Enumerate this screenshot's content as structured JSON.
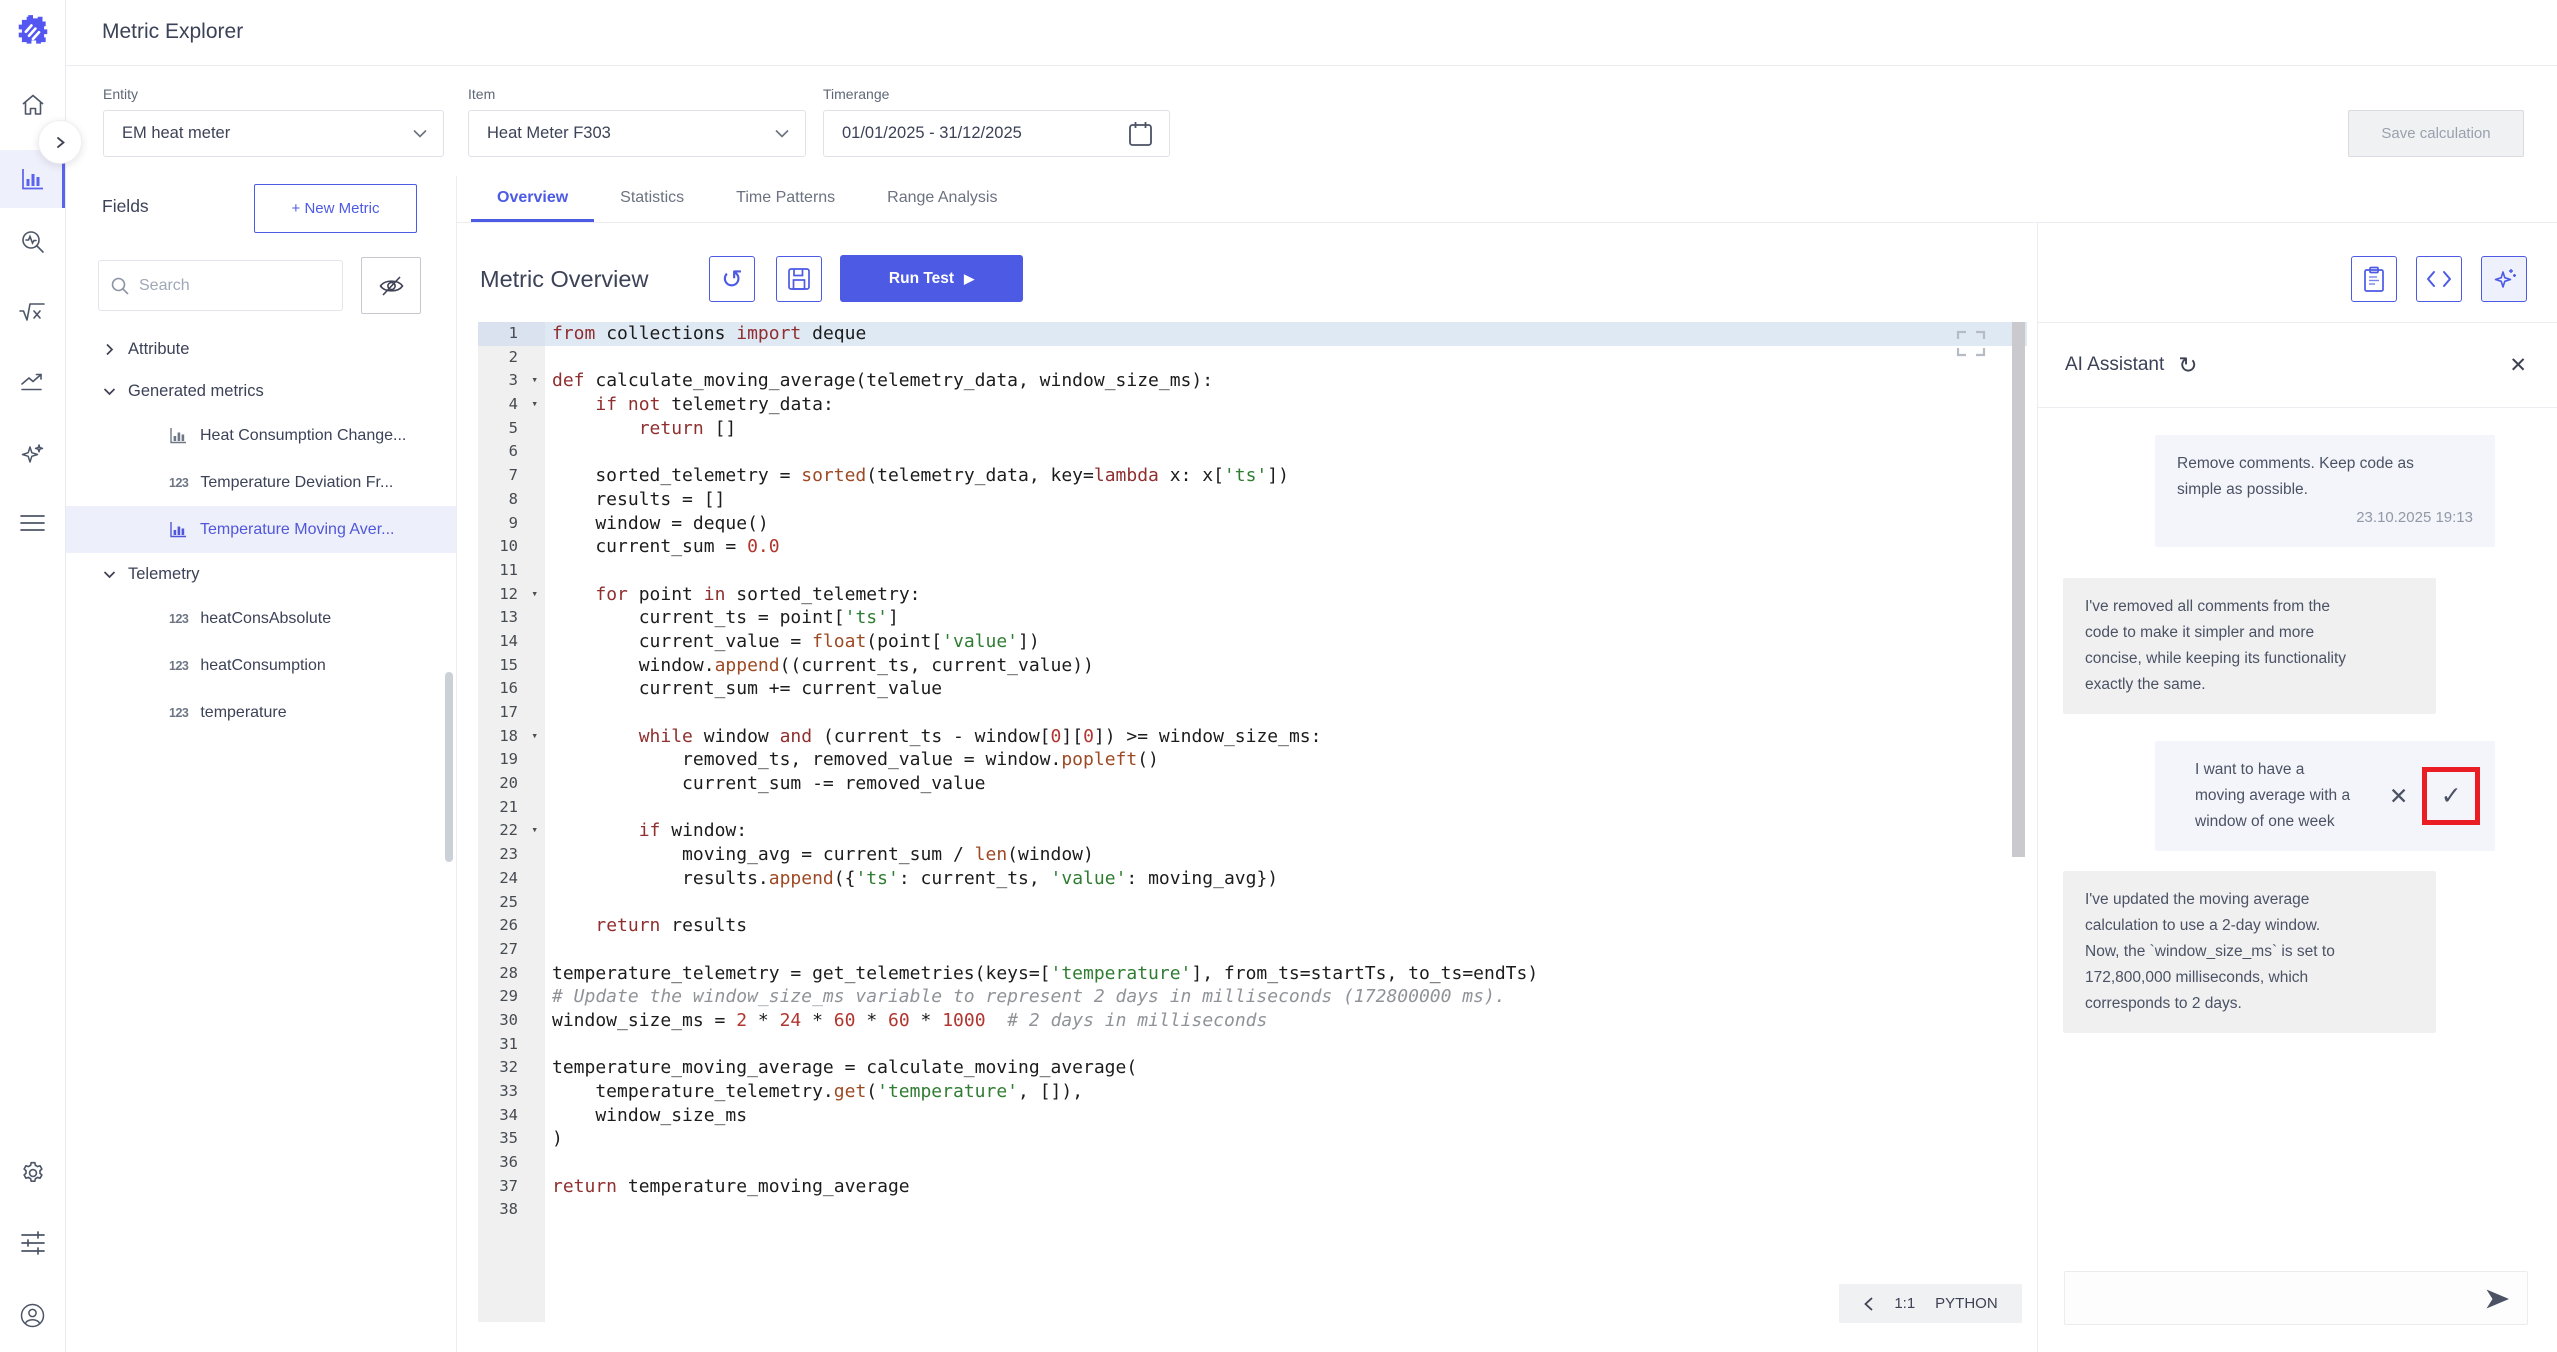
{
  "app": {
    "title": "Metric Explorer"
  },
  "colors": {
    "accent": "#4c5ae4",
    "annotation": "#ea1c24",
    "active_line": "#dfe9f4",
    "selected_bg": "#edeffb"
  },
  "topbar": {
    "entity": {
      "label": "Entity",
      "value": "EM heat meter"
    },
    "item": {
      "label": "Item",
      "value": "Heat Meter F303"
    },
    "timerange": {
      "label": "Timerange",
      "value": "01/01/2025 - 31/12/2025"
    },
    "save_button": "Save calculation"
  },
  "fields": {
    "title": "Fields",
    "new_metric_button": "+ New Metric",
    "search_placeholder": "Search",
    "tree": [
      {
        "label": "Attribute",
        "expanded": false,
        "children": []
      },
      {
        "label": "Generated metrics",
        "expanded": true,
        "children": [
          {
            "icon": "bar-chart",
            "label": "Heat Consumption Change...",
            "selected": false
          },
          {
            "icon": "123",
            "label": "Temperature Deviation Fr...",
            "selected": false
          },
          {
            "icon": "bar-chart",
            "label": "Temperature Moving Aver...",
            "selected": true
          }
        ]
      },
      {
        "label": "Telemetry",
        "expanded": true,
        "children": [
          {
            "icon": "123",
            "label": "heatConsAbsolute",
            "selected": false
          },
          {
            "icon": "123",
            "label": "heatConsumption",
            "selected": false
          },
          {
            "icon": "123",
            "label": "temperature",
            "selected": false
          }
        ]
      }
    ]
  },
  "tabs": {
    "active_index": 0,
    "items": [
      "Overview",
      "Statistics",
      "Time Patterns",
      "Range Analysis"
    ]
  },
  "toolbar": {
    "title": "Metric Overview",
    "run_test": {
      "label": "Run Test",
      "icon": "▶"
    }
  },
  "editor": {
    "status": {
      "cursor": "1:1",
      "language": "PYTHON"
    },
    "active_line": 1,
    "fold_lines": [
      3,
      4,
      12,
      18,
      22
    ],
    "lines": [
      [
        [
          "kw",
          "from"
        ],
        [
          "pl",
          " collections "
        ],
        [
          "kw",
          "import"
        ],
        [
          "pl",
          " deque"
        ]
      ],
      [],
      [
        [
          "kw",
          "def"
        ],
        [
          "pl",
          " calculate_moving_average(telemetry_data, window_size_ms):"
        ]
      ],
      [
        [
          "pl",
          "    "
        ],
        [
          "kw",
          "if"
        ],
        [
          "pl",
          " "
        ],
        [
          "kw",
          "not"
        ],
        [
          "pl",
          " telemetry_data:"
        ]
      ],
      [
        [
          "pl",
          "        "
        ],
        [
          "kw",
          "return"
        ],
        [
          "pl",
          " []"
        ]
      ],
      [],
      [
        [
          "pl",
          "    sorted_telemetry = "
        ],
        [
          "bn",
          "sorted"
        ],
        [
          "pl",
          "(telemetry_data, key="
        ],
        [
          "kw",
          "lambda"
        ],
        [
          "pl",
          " x: x["
        ],
        [
          "st",
          "'ts'"
        ],
        [
          "pl",
          "])"
        ]
      ],
      [
        [
          "pl",
          "    results = []"
        ]
      ],
      [
        [
          "pl",
          "    window = deque()"
        ]
      ],
      [
        [
          "pl",
          "    current_sum = "
        ],
        [
          "nm",
          "0.0"
        ]
      ],
      [],
      [
        [
          "pl",
          "    "
        ],
        [
          "kw",
          "for"
        ],
        [
          "pl",
          " point "
        ],
        [
          "kw",
          "in"
        ],
        [
          "pl",
          " sorted_telemetry:"
        ]
      ],
      [
        [
          "pl",
          "        current_ts = point["
        ],
        [
          "st",
          "'ts'"
        ],
        [
          "pl",
          "]"
        ]
      ],
      [
        [
          "pl",
          "        current_value = "
        ],
        [
          "bn",
          "float"
        ],
        [
          "pl",
          "(point["
        ],
        [
          "st",
          "'value'"
        ],
        [
          "pl",
          "])"
        ]
      ],
      [
        [
          "pl",
          "        window."
        ],
        [
          "bn",
          "append"
        ],
        [
          "pl",
          "((current_ts, current_value))"
        ]
      ],
      [
        [
          "pl",
          "        current_sum += current_value"
        ]
      ],
      [],
      [
        [
          "pl",
          "        "
        ],
        [
          "kw",
          "while"
        ],
        [
          "pl",
          " window "
        ],
        [
          "kw",
          "and"
        ],
        [
          "pl",
          " (current_ts - window["
        ],
        [
          "nm",
          "0"
        ],
        [
          "pl",
          "]["
        ],
        [
          "nm",
          "0"
        ],
        [
          "pl",
          "]) >= window_size_ms:"
        ]
      ],
      [
        [
          "pl",
          "            removed_ts, removed_value = window."
        ],
        [
          "bn",
          "popleft"
        ],
        [
          "pl",
          "()"
        ]
      ],
      [
        [
          "pl",
          "            current_sum -= removed_value"
        ]
      ],
      [],
      [
        [
          "pl",
          "        "
        ],
        [
          "kw",
          "if"
        ],
        [
          "pl",
          " window:"
        ]
      ],
      [
        [
          "pl",
          "            moving_avg = current_sum / "
        ],
        [
          "bn",
          "len"
        ],
        [
          "pl",
          "(window)"
        ]
      ],
      [
        [
          "pl",
          "            results."
        ],
        [
          "bn",
          "append"
        ],
        [
          "pl",
          "({"
        ],
        [
          "st",
          "'ts'"
        ],
        [
          "pl",
          ": current_ts, "
        ],
        [
          "st",
          "'value'"
        ],
        [
          "pl",
          ": moving_avg})"
        ]
      ],
      [],
      [
        [
          "pl",
          "    "
        ],
        [
          "kw",
          "return"
        ],
        [
          "pl",
          " results"
        ]
      ],
      [],
      [
        [
          "pl",
          "temperature_telemetry = get_telemetries(keys=["
        ],
        [
          "st",
          "'temperature'"
        ],
        [
          "pl",
          "], from_ts=startTs, to_ts=endTs)"
        ]
      ],
      [
        [
          "cm",
          "# Update the window_size_ms variable to represent 2 days in milliseconds (172800000 ms)."
        ]
      ],
      [
        [
          "pl",
          "window_size_ms = "
        ],
        [
          "nm",
          "2"
        ],
        [
          "pl",
          " * "
        ],
        [
          "nm",
          "24"
        ],
        [
          "pl",
          " * "
        ],
        [
          "nm",
          "60"
        ],
        [
          "pl",
          " * "
        ],
        [
          "nm",
          "60"
        ],
        [
          "pl",
          " * "
        ],
        [
          "nm",
          "1000"
        ],
        [
          "pl",
          "  "
        ],
        [
          "cm",
          "# 2 days in milliseconds"
        ]
      ],
      [],
      [
        [
          "pl",
          "temperature_moving_average = calculate_moving_average("
        ]
      ],
      [
        [
          "pl",
          "    temperature_telemetry."
        ],
        [
          "bn",
          "get"
        ],
        [
          "pl",
          "("
        ],
        [
          "st",
          "'temperature'"
        ],
        [
          "pl",
          ", []),"
        ]
      ],
      [
        [
          "pl",
          "    window_size_ms"
        ]
      ],
      [
        [
          "pl",
          ")"
        ]
      ],
      [],
      [
        [
          "kw",
          "return"
        ],
        [
          "pl",
          " temperature_moving_average"
        ]
      ],
      []
    ]
  },
  "assistant": {
    "title": "AI Assistant",
    "messages": [
      {
        "role": "user",
        "text": "Remove comments. Keep code as\nsimple as possible.",
        "timestamp": "23.10.2025 19:13"
      },
      {
        "role": "assistant",
        "text": "I've removed all comments from the\ncode to make it simpler and more\nconcise, while keeping its functionality\nexactly the same."
      },
      {
        "role": "user",
        "text": "I want to have a\nmoving average with a\nwindow of one week",
        "actions": [
          "dismiss",
          "accept"
        ],
        "annotated_action": "accept"
      },
      {
        "role": "assistant",
        "text": "I've updated the moving average\ncalculation to use a 2-day window.\nNow, the `window_size_ms` is set to\n172,800,000 milliseconds, which\ncorresponds to 2 days."
      }
    ]
  }
}
